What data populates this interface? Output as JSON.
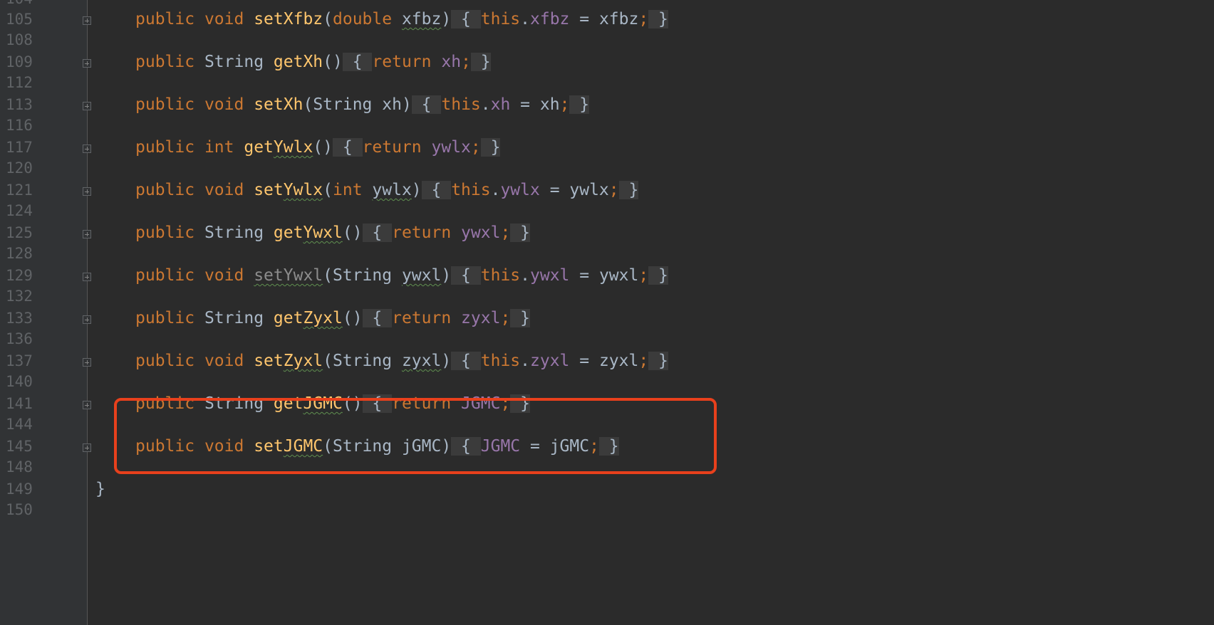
{
  "line_numbers": [
    "105",
    "108",
    "109",
    "112",
    "113",
    "116",
    "117",
    "120",
    "121",
    "124",
    "125",
    "128",
    "129",
    "132",
    "133",
    "136",
    "137",
    "140",
    "141",
    "144",
    "145",
    "148",
    "149",
    "150"
  ],
  "partial_line_number_top": "104",
  "code": {
    "l105": {
      "kw1": "public",
      "kw2": "void",
      "fn": "setXfbz",
      "p1": "(",
      "kw3": "double",
      "arg": "xfbz",
      "p2": ")",
      "b1": " { ",
      "kw4": "this",
      "dot": ".",
      "field": "xfbz",
      "eq": " = ",
      "val": "xfbz",
      "semi": ";",
      "b2": " }"
    },
    "l109": {
      "kw1": "public",
      "type": "String",
      "fn": "getXh",
      "p": "()",
      "b1": " { ",
      "kw2": "return",
      "field": "xh",
      "semi": ";",
      "b2": " }"
    },
    "l113": {
      "kw1": "public",
      "kw2": "void",
      "fn": "setXh",
      "p1": "(",
      "type": "String",
      "arg": "xh",
      "p2": ")",
      "b1": " { ",
      "kw3": "this",
      "dot": ".",
      "field": "xh",
      "eq": " = ",
      "val": "xh",
      "semi": ";",
      "b2": " }"
    },
    "l117": {
      "kw1": "public",
      "kw2": "int",
      "fn_a": "get",
      "fn_b": "Ywlx",
      "p": "()",
      "b1": " { ",
      "kw3": "return",
      "field": "ywlx",
      "semi": ";",
      "b2": " }"
    },
    "l121": {
      "kw1": "public",
      "kw2": "void",
      "fn_a": "set",
      "fn_b": "Ywlx",
      "p1": "(",
      "kw3": "int",
      "arg": "ywlx",
      "p2": ")",
      "b1": " { ",
      "kw4": "this",
      "dot": ".",
      "field": "ywlx",
      "eq": " = ",
      "val": "ywlx",
      "semi": ";",
      "b2": " }"
    },
    "l125": {
      "kw1": "public",
      "type": "String",
      "fn_a": "get",
      "fn_b": "Ywxl",
      "p": "()",
      "b1": " { ",
      "kw2": "return",
      "field": "ywxl",
      "semi": ";",
      "b2": " }"
    },
    "l129": {
      "kw1": "public",
      "kw2": "void",
      "fn": "setYwxl",
      "p1": "(",
      "type": "String",
      "arg": "ywxl",
      "p2": ")",
      "b1": " { ",
      "kw3": "this",
      "dot": ".",
      "field": "ywxl",
      "eq": " = ",
      "val": "ywxl",
      "semi": ";",
      "b2": " }"
    },
    "l133": {
      "kw1": "public",
      "type": "String",
      "fn_a": "get",
      "fn_b": "Zyxl",
      "p": "()",
      "b1": " { ",
      "kw2": "return",
      "field": "zyxl",
      "semi": ";",
      "b2": " }"
    },
    "l137": {
      "kw1": "public",
      "kw2": "void",
      "fn_a": "set",
      "fn_b": "Zyxl",
      "p1": "(",
      "type": "String",
      "arg": "zyxl",
      "p2": ")",
      "b1": " { ",
      "kw3": "this",
      "dot": ".",
      "field": "zyxl",
      "eq": " = ",
      "val": "zyxl",
      "semi": ";",
      "b2": " }"
    },
    "l141": {
      "kw1": "public",
      "type": "String",
      "fn_a": "get",
      "fn_b": "JGMC",
      "p": "()",
      "b1": " { ",
      "kw2": "return",
      "field": "JGMC",
      "semi": ";",
      "b2": " }"
    },
    "l145": {
      "kw1": "public",
      "kw2": "void",
      "fn_a": "set",
      "fn_b": "JGMC",
      "p1": "(",
      "type": "String",
      "arg": "jGMC",
      "p2": ")",
      "b1": " { ",
      "field": "JGMC",
      "eq": " = ",
      "val": "jGMC",
      "semi": ";",
      "b2": " }"
    },
    "l149": {
      "brace": "}"
    }
  },
  "colors": {
    "background": "#2b2b2b",
    "keyword": "#cc7832",
    "function": "#ffc66d",
    "field": "#9876aa",
    "plain": "#a9b7c6",
    "highlight_box": "#e8401c"
  }
}
